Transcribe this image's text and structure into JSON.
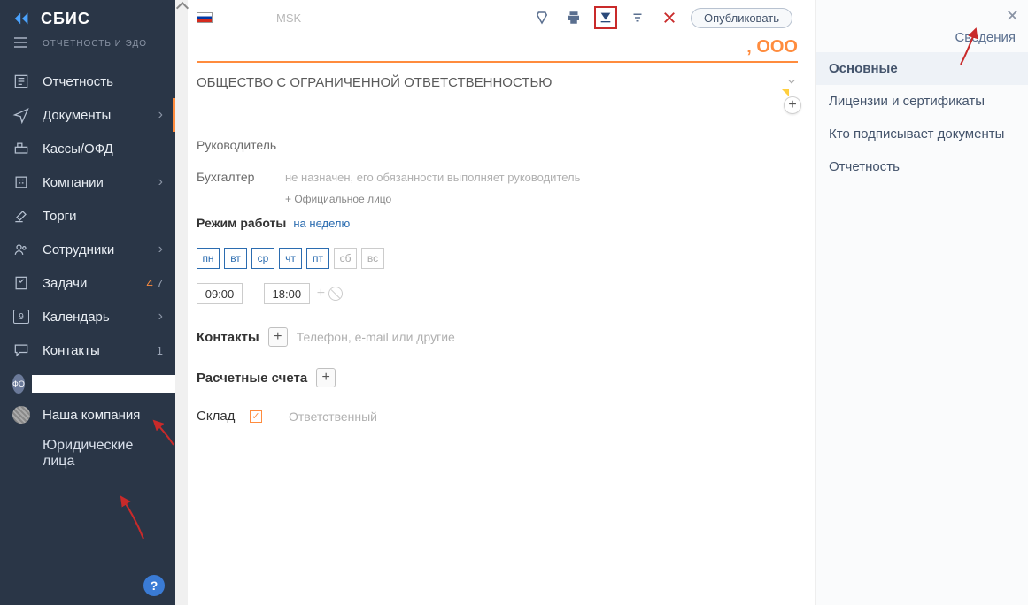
{
  "app": {
    "name": "СБИС",
    "subtitle": "ОТЧЕТНОСТЬ И ЭДО"
  },
  "sidebar": {
    "items": [
      {
        "label": "Отчетность"
      },
      {
        "label": "Документы"
      },
      {
        "label": "Кассы/ОФД"
      },
      {
        "label": "Компании"
      },
      {
        "label": "Торги"
      },
      {
        "label": "Сотрудники"
      },
      {
        "label": "Задачи",
        "count1": "4",
        "count2": "7"
      },
      {
        "label": "Календарь"
      },
      {
        "label": "Контакты",
        "count2": "1"
      }
    ],
    "avatar": "ФО",
    "ourCompany": "Наша компания",
    "legal": "Юридические лица"
  },
  "toolbar": {
    "tz": "MSK",
    "publish": "Опубликовать"
  },
  "title": {
    "suffix": ", ООО"
  },
  "orgType": "ОБЩЕСТВО С ОГРАНИЧЕННОЙ ОТВЕТСТВЕННОСТЬЮ",
  "fields": {
    "headLabel": "Руководитель",
    "accLabel": "Бухгалтер",
    "accValue": "не назначен, его обязанности выполняет руководитель",
    "addOfficial": "Официальное лицо",
    "scheduleLabel": "Режим работы",
    "scheduleLink": "на неделю",
    "days": [
      "пн",
      "вт",
      "ср",
      "чт",
      "пт",
      "сб",
      "вс"
    ],
    "timeFrom": "09:00",
    "timeTo": "18:00",
    "contactsLabel": "Контакты",
    "contactsPlaceholder": "Телефон, e-mail или другие",
    "accountsLabel": "Расчетные счета",
    "stockLabel": "Склад",
    "stockValue": "Ответственный"
  },
  "rightPanel": {
    "title": "Сведения",
    "items": [
      "Основные",
      "Лицензии и сертификаты",
      "Кто подписывает документы",
      "Отчетность"
    ]
  },
  "help": "?"
}
